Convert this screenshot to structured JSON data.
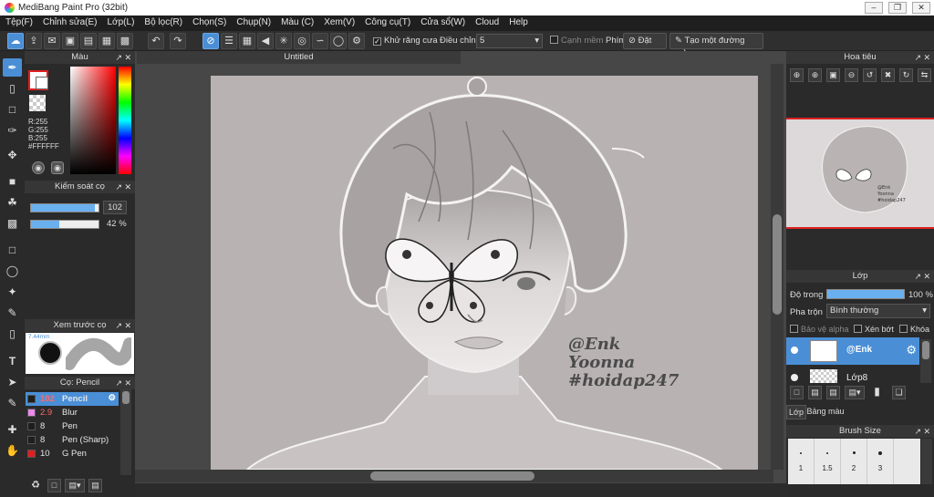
{
  "window": {
    "title": "MediBang Paint Pro (32bit)"
  },
  "menu": [
    "Tệp(F)",
    "Chỉnh sửa(E)",
    "Lớp(L)",
    "Bộ lọc(R)",
    "Chọn(S)",
    "Chụp(N)",
    "Màu (C)",
    "Xem(V)",
    "Công cụ(T)",
    "Cửa sổ(W)",
    "Cloud",
    "Help"
  ],
  "toolbar": {
    "antialias_label": "Khử răng cưa",
    "adjust_label": "Điều chỉnh",
    "adjust_value": "5",
    "edge_label": "Cạnh mềm",
    "key_label": "Phím",
    "reset_label": "Đặt lại",
    "straight_line_label": "Tạo một đường thẳng"
  },
  "color_panel": {
    "title": "Màu",
    "r": "R:255",
    "g": "G:255",
    "b": "B:255",
    "hex": "#FFFFFF",
    "primary": "#ffffff"
  },
  "brush_control": {
    "title": "Kiểm soát cọ",
    "size": "102",
    "size_fraction": 0.95,
    "opacity": "42 %",
    "opacity_fraction": 0.42
  },
  "brush_preview": {
    "title": "Xem trước cọ",
    "size_label": "7.44mm"
  },
  "brush_list": {
    "title": "Cọ: Pencil",
    "items": [
      {
        "size": "102",
        "name": "Pencil",
        "color": "#1e1e1e",
        "selected": true
      },
      {
        "size": "2.9",
        "name": "Blur",
        "color": "#e88ae8",
        "selected": false
      },
      {
        "size": "8",
        "name": "Pen",
        "color": "#1e1e1e",
        "selected": false
      },
      {
        "size": "8",
        "name": "Pen (Sharp)",
        "color": "#1e1e1e",
        "selected": false
      },
      {
        "size": "10",
        "name": "G Pen",
        "color": "#e02020",
        "selected": false
      }
    ]
  },
  "canvas": {
    "tab_title": "Untitled",
    "watermark_lines": [
      "@Enk",
      "Yoonna",
      "#hoidap247"
    ]
  },
  "navigator": {
    "title": "Hoa tiêu"
  },
  "layer_panel": {
    "title": "Lớp",
    "opacity_label": "Độ trong",
    "opacity_value": "100 %",
    "blend_label": "Pha trộn",
    "blend_value": "Bình thường",
    "protect_alpha": "Bảo vệ alpha",
    "clip": "Xén bớt",
    "lock": "Khóa",
    "layers": [
      {
        "name": "@Enk",
        "selected": true
      },
      {
        "name": "Lớp8",
        "selected": false
      }
    ],
    "tabs": [
      "Lớp",
      "Bảng màu"
    ]
  },
  "brush_size_panel": {
    "title": "Brush Size",
    "sizes": [
      "1",
      "1.5",
      "2",
      "3"
    ]
  }
}
